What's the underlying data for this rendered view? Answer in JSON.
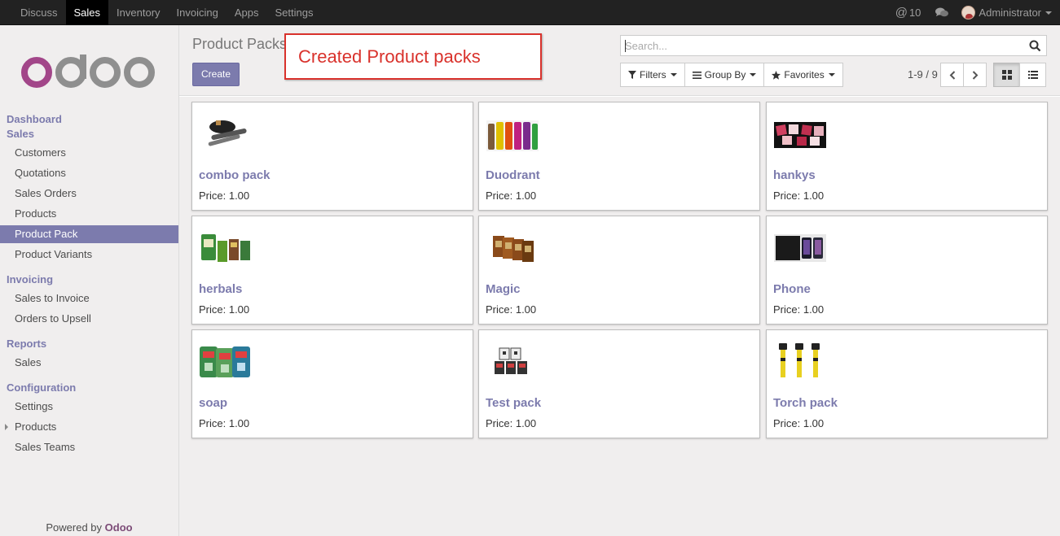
{
  "topbar": {
    "menu": [
      "Discuss",
      "Sales",
      "Inventory",
      "Invoicing",
      "Apps",
      "Settings"
    ],
    "active": "Sales",
    "mentions_count": "10",
    "user": "Administrator"
  },
  "sidebar": {
    "logo": "odoo",
    "sections": [
      {
        "title": "Dashboard",
        "items": []
      },
      {
        "title": "Sales",
        "items": [
          "Customers",
          "Quotations",
          "Sales Orders",
          "Products",
          "Product Pack",
          "Product Variants"
        ]
      },
      {
        "title": "Invoicing",
        "items": [
          "Sales to Invoice",
          "Orders to Upsell"
        ]
      },
      {
        "title": "Reports",
        "items": [
          "Sales"
        ]
      },
      {
        "title": "Configuration",
        "items": [
          "Settings",
          "Products",
          "Sales Teams"
        ]
      }
    ],
    "active_item": "Product Pack",
    "powered_by": "Powered by",
    "powered_brand": "Odoo"
  },
  "control_panel": {
    "breadcrumb": "Product Packs",
    "create_label": "Create",
    "annotation": "Created Product packs",
    "search_placeholder": "Search...",
    "filters_label": "Filters",
    "groupby_label": "Group By",
    "favorites_label": "Favorites",
    "pager": "1-9 / 9"
  },
  "products": [
    {
      "name": "combo pack",
      "price": "Price: 1.00",
      "icon": "bag-and-rolls-image"
    },
    {
      "name": "Duodrant",
      "price": "Price: 1.00",
      "icon": "deodorant-bottles-image"
    },
    {
      "name": "hankys",
      "price": "Price: 1.00",
      "icon": "handkerchiefs-image"
    },
    {
      "name": "herbals",
      "price": "Price: 1.00",
      "icon": "herbal-packs-image"
    },
    {
      "name": "Magic",
      "price": "Price: 1.00",
      "icon": "magic-boxes-image"
    },
    {
      "name": "Phone",
      "price": "Price: 1.00",
      "icon": "phones-image"
    },
    {
      "name": "soap",
      "price": "Price: 1.00",
      "icon": "soap-packs-image"
    },
    {
      "name": "Test pack",
      "price": "Price: 1.00",
      "icon": "test-pack-image"
    },
    {
      "name": "Torch pack",
      "price": "Price: 1.00",
      "icon": "torches-image"
    }
  ],
  "colors": {
    "accent": "#7c7bad",
    "annotation": "#d9322c",
    "brand": "#7c4b77"
  }
}
